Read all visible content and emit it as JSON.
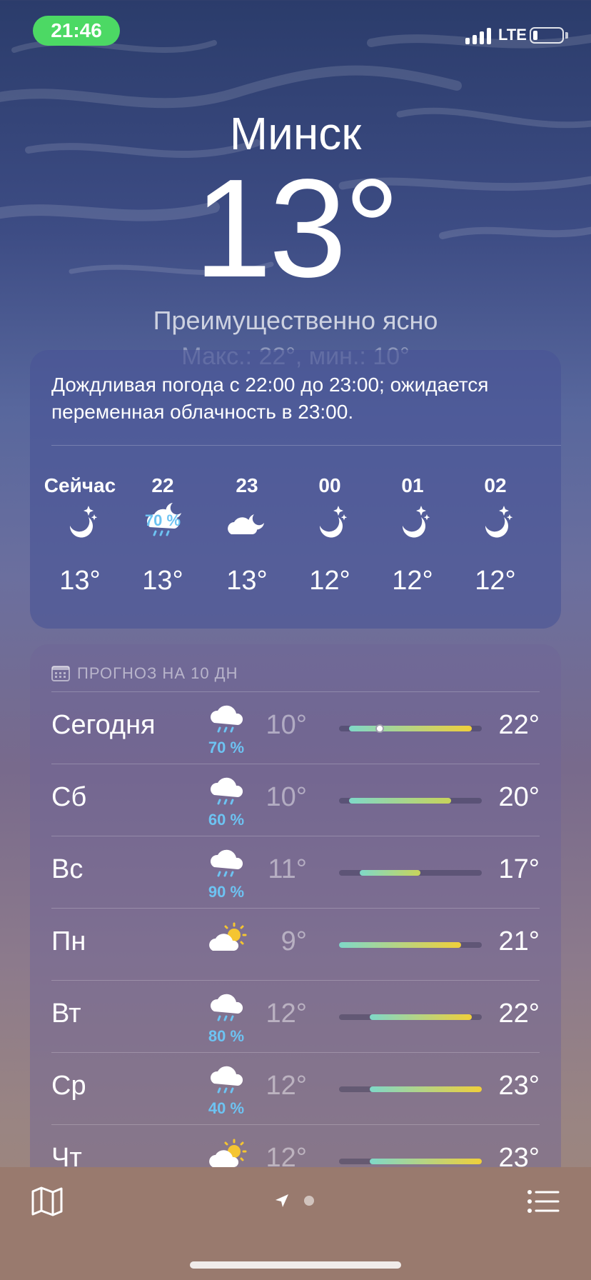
{
  "status_bar": {
    "time": "21:46",
    "network": "LTE"
  },
  "location": {
    "city": "Минск",
    "temperature": "13°",
    "condition": "Преимущественно ясно",
    "hilo_partial": "Макс.: 22°, мин.: 10°"
  },
  "hourly": {
    "summary": "Дождливая погода с 22:00 до 23:00; ожидается переменная облачность в 23:00.",
    "items": [
      {
        "label": "Сейчас",
        "icon": "moon-stars-icon",
        "precip": "",
        "temp": "13°"
      },
      {
        "label": "22",
        "icon": "cloud-moon-rain-icon",
        "precip": "70 %",
        "temp": "13°"
      },
      {
        "label": "23",
        "icon": "cloud-moon-icon",
        "precip": "",
        "temp": "13°"
      },
      {
        "label": "00",
        "icon": "moon-stars-icon",
        "precip": "",
        "temp": "12°"
      },
      {
        "label": "01",
        "icon": "moon-stars-icon",
        "precip": "",
        "temp": "12°"
      },
      {
        "label": "02",
        "icon": "moon-stars-icon",
        "precip": "",
        "temp": "12°"
      }
    ]
  },
  "daily": {
    "header": "ПРОГНОЗ НА 10 ДН",
    "days": [
      {
        "name": "Сегодня",
        "icon": "cloud-rain-icon",
        "precip": "70 %",
        "low": "10°",
        "high": "22°"
      },
      {
        "name": "Сб",
        "icon": "cloud-rain-icon",
        "precip": "60 %",
        "low": "10°",
        "high": "20°"
      },
      {
        "name": "Вс",
        "icon": "cloud-rain-icon",
        "precip": "90 %",
        "low": "11°",
        "high": "17°"
      },
      {
        "name": "Пн",
        "icon": "cloud-sun-icon",
        "precip": "",
        "low": "9°",
        "high": "21°"
      },
      {
        "name": "Вт",
        "icon": "cloud-rain-icon",
        "precip": "80 %",
        "low": "12°",
        "high": "22°"
      },
      {
        "name": "Ср",
        "icon": "cloud-rain-icon",
        "precip": "40 %",
        "low": "12°",
        "high": "23°"
      },
      {
        "name": "Чт",
        "icon": "cloud-sun-icon",
        "precip": "",
        "low": "12°",
        "high": "23°"
      }
    ],
    "range_min": 9,
    "range_max": 23,
    "current_temp_value": 13
  },
  "colors": {
    "accent_precip": "#6dc3f2",
    "status_pill": "#4cd964",
    "bar_cool": "#7fd8c8",
    "bar_warm": "#f0cf3a"
  }
}
